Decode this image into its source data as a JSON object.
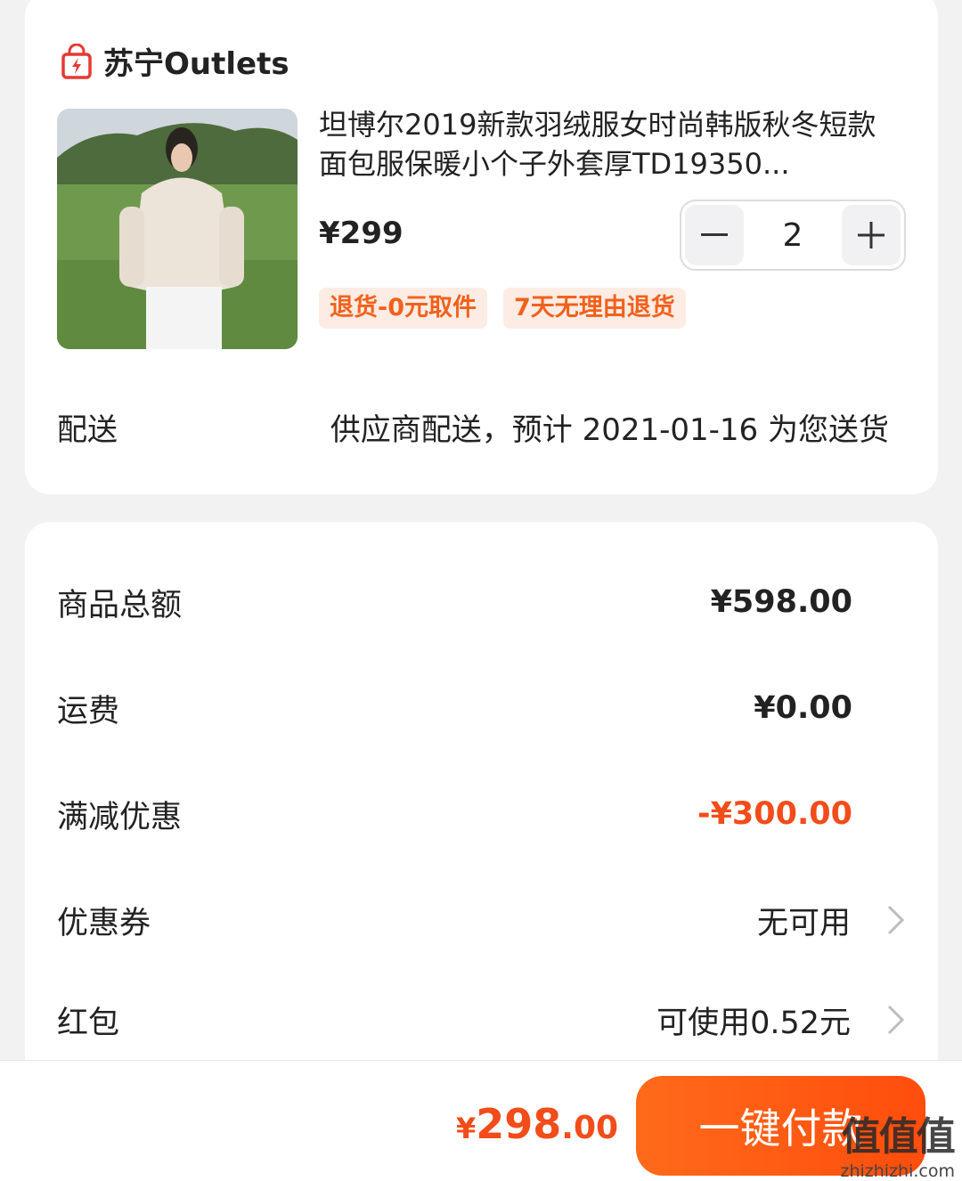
{
  "store": {
    "name": "苏宁Outlets",
    "icon": "shopping-bag-icon"
  },
  "product": {
    "title": "坦博尔2019新款羽绒服女时尚韩版秋冬短款面包服保暖小个子外套厚TD19350...",
    "price": "¥299",
    "quantity": "2",
    "tags": [
      "退货-0元取件",
      "7天无理由退货"
    ]
  },
  "delivery": {
    "label": "配送",
    "value": "供应商配送，预计 2021-01-16 为您送货"
  },
  "summary": {
    "goods_total": {
      "label": "商品总额",
      "value": "¥598.00"
    },
    "shipping": {
      "label": "运费",
      "value": "¥0.00"
    },
    "discount": {
      "label": "满减优惠",
      "value": "-¥300.00"
    },
    "coupon": {
      "label": "优惠券",
      "value": "无可用"
    },
    "redpacket": {
      "label": "红包",
      "value": "可使用0.52元"
    }
  },
  "bottom": {
    "total_currency": "¥",
    "total_int": "298",
    "total_dec": ".00",
    "pay_label": "一键付款"
  },
  "watermark": {
    "big": "值值值",
    "small": "zhizhizhi.com"
  },
  "colors": {
    "accent": "#f24c1a",
    "button": "#ff5a14",
    "tag_bg": "#fdece3"
  }
}
